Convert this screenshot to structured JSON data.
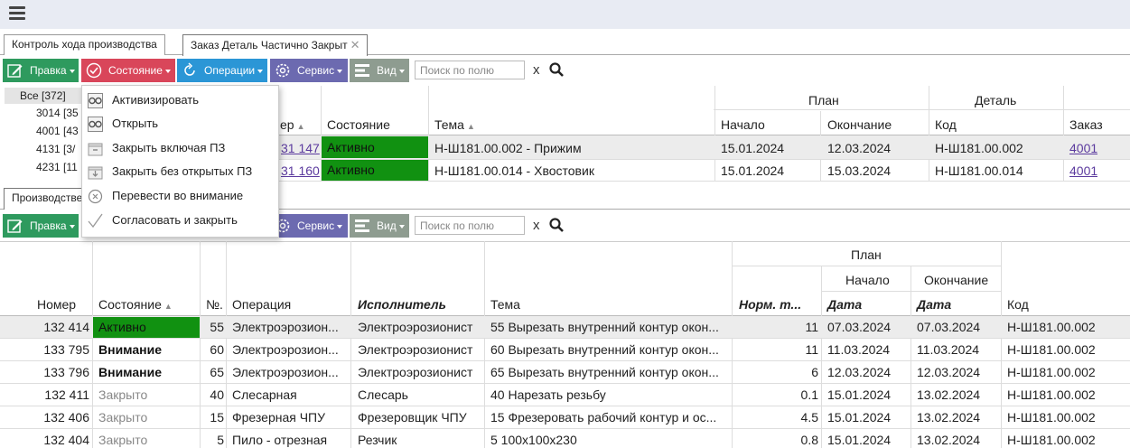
{
  "tabs": {
    "control": "Контроль хода производства",
    "order": "Заказ Деталь Частично Закрыт",
    "close_icon": "✕"
  },
  "toolbar1": {
    "edit": "Правка",
    "state": "Состояние",
    "ops": "Операции",
    "service": "Сервис",
    "view": "Вид",
    "search_placeholder": "Поиск по полю",
    "clear": "x"
  },
  "toolbar2": {
    "edit": "Правка",
    "service": "Сервис",
    "view": "Вид",
    "search_placeholder": "Поиск по полю",
    "clear": "x"
  },
  "tree": {
    "all": "Все [372]",
    "n1": "3014 [35",
    "n2": "4001 [43",
    "n3": "4131 [3/",
    "n4": "4231 [11"
  },
  "lower_tab": "Производстве",
  "dropdown": [
    "Активизировать",
    "Открыть",
    "Закрыть включая ПЗ",
    "Закрыть без открытых ПЗ",
    "Перевести во внимание",
    "Согласовать и закрыть"
  ],
  "grid1": {
    "group_plan": "План",
    "group_detail": "Деталь",
    "cols": {
      "number": "ер",
      "state": "Состояние",
      "topic": "Тема",
      "start": "Начало",
      "end": "Окончание",
      "code": "Код",
      "order": "Заказ"
    },
    "rows": [
      {
        "number": "31 147",
        "state": "Активно",
        "topic": "Н-Ш181.00.002 - Прижим",
        "start": "15.01.2024",
        "end": "12.03.2024",
        "code": "Н-Ш181.00.002",
        "order": "4001"
      },
      {
        "number": "31 160",
        "state": "Активно",
        "topic": "Н-Ш181.00.014 - Хвостовик",
        "start": "15.01.2024",
        "end": "15.03.2024",
        "code": "Н-Ш181.00.014",
        "order": "4001"
      }
    ]
  },
  "grid2": {
    "group_plan": "План",
    "sub_start": "Начало",
    "sub_end": "Окончание",
    "cols": {
      "number": "Номер",
      "state": "Состояние",
      "no": "№.",
      "operation": "Операция",
      "performer": "Исполнитель",
      "topic": "Тема",
      "norm": "Норм. т...",
      "date1": "Дата",
      "date2": "Дата",
      "code": "Код"
    },
    "rows": [
      {
        "number": "132 414",
        "state": "Активно",
        "no": "55",
        "operation": "Электроэрозион...",
        "performer": "Электроэрозионист",
        "topic": "55 Вырезать внутренний контур окон...",
        "norm": "11",
        "d1": "07.03.2024",
        "d2": "07.03.2024",
        "code": "Н-Ш181.00.002"
      },
      {
        "number": "133 795",
        "state": "Внимание",
        "no": "60",
        "operation": "Электроэрозион...",
        "performer": "Электроэрозионист",
        "topic": "60 Вырезать внутренний контур окон...",
        "norm": "11",
        "d1": "11.03.2024",
        "d2": "11.03.2024",
        "code": "Н-Ш181.00.002"
      },
      {
        "number": "133 796",
        "state": "Внимание",
        "no": "65",
        "operation": "Электроэрозион...",
        "performer": "Электроэрозионист",
        "topic": "65 Вырезать внутренний контур окон...",
        "norm": "6",
        "d1": "12.03.2024",
        "d2": "12.03.2024",
        "code": "Н-Ш181.00.002"
      },
      {
        "number": "132 411",
        "state": "Закрыто",
        "no": "40",
        "operation": "Слесарная",
        "performer": "Слесарь",
        "topic": "40 Нарезать резьбу",
        "norm": "0.1",
        "d1": "15.01.2024",
        "d2": "13.02.2024",
        "code": "Н-Ш181.00.002"
      },
      {
        "number": "132 406",
        "state": "Закрыто",
        "no": "15",
        "operation": "Фрезерная ЧПУ",
        "performer": "Фрезеровщик ЧПУ",
        "topic": "15 Фрезеровать рабочий контур и ос...",
        "norm": "4.5",
        "d1": "15.01.2024",
        "d2": "13.02.2024",
        "code": "Н-Ш181.00.002"
      },
      {
        "number": "132 404",
        "state": "Закрыто",
        "no": "5",
        "operation": "Пило - отрезная",
        "performer": "Резчик",
        "topic": "5 100х100х230",
        "norm": "0.8",
        "d1": "15.01.2024",
        "d2": "13.02.2024",
        "code": "Н-Ш181.00.002"
      }
    ]
  }
}
